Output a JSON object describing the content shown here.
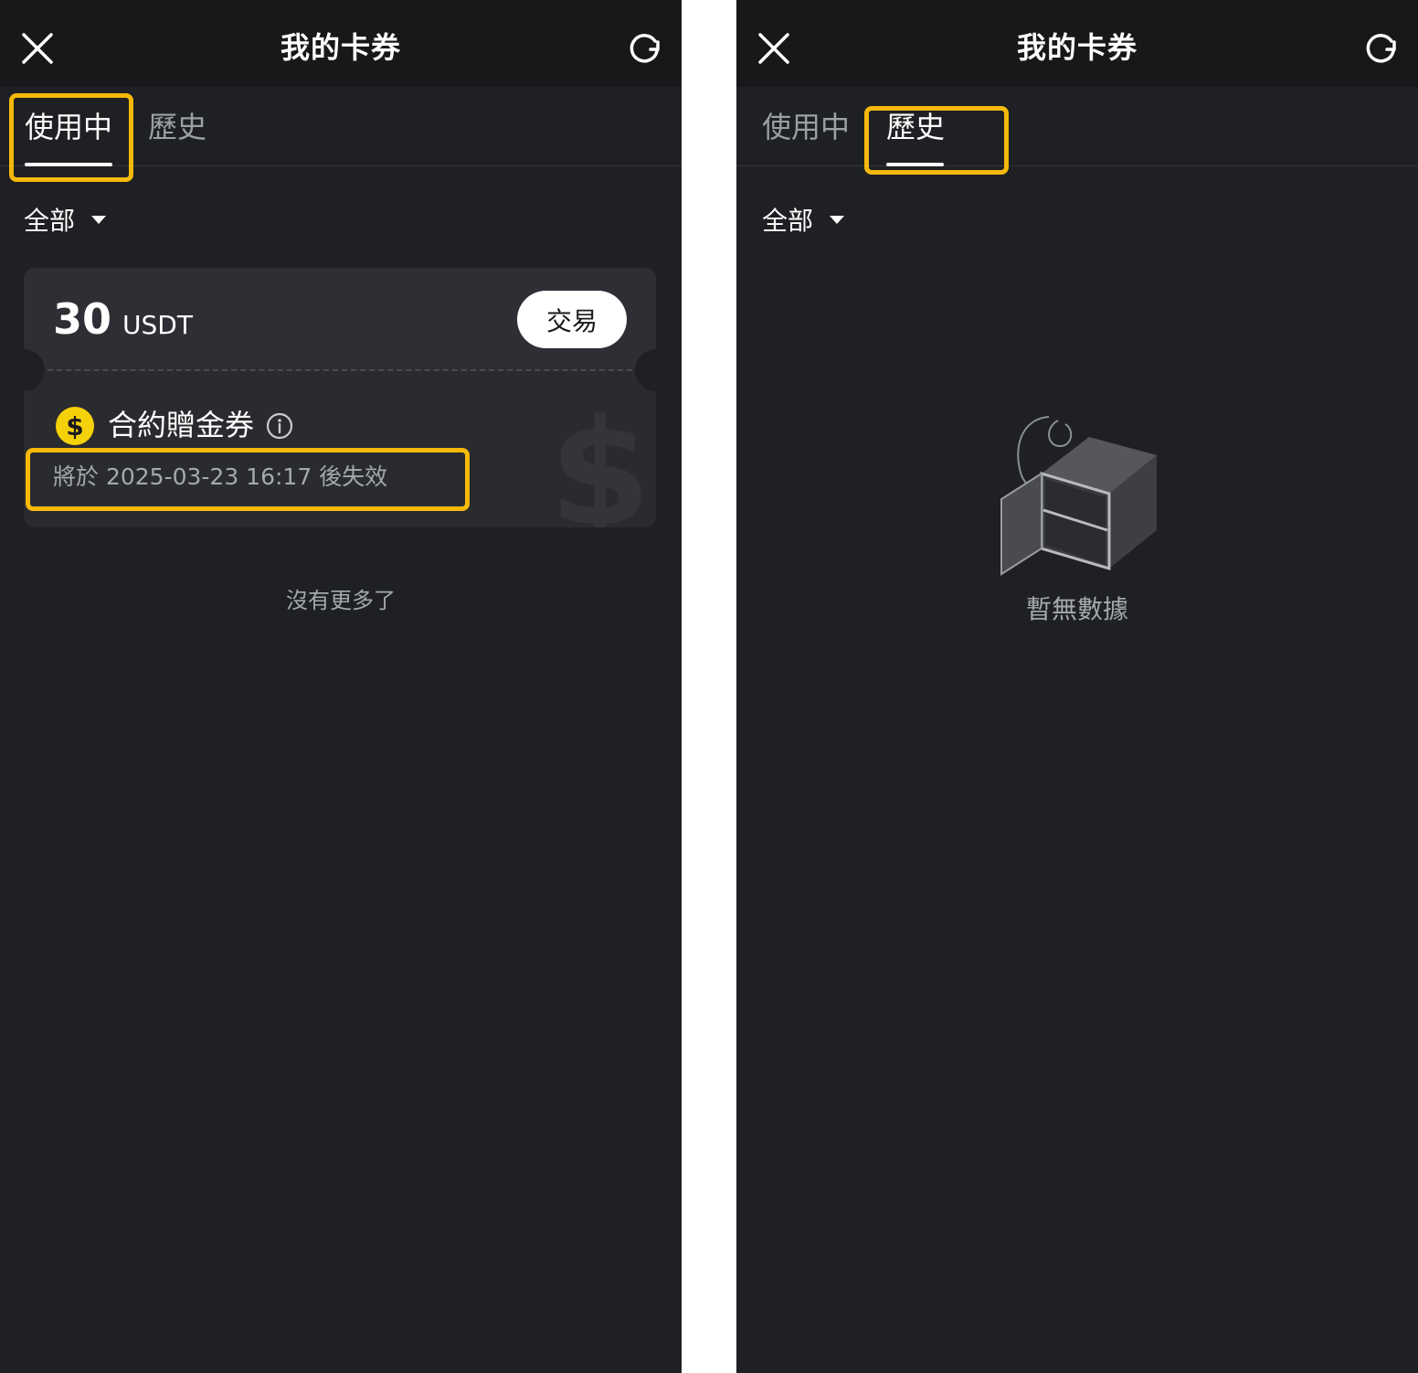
{
  "left_panel": {
    "header": {
      "title": "我的卡券"
    },
    "tabs": [
      {
        "label": "使用中",
        "active": true
      },
      {
        "label": "歷史",
        "active": false
      }
    ],
    "filter": {
      "label": "全部"
    },
    "coupon": {
      "amount": "30",
      "unit": "USDT",
      "action_label": "交易",
      "coin_symbol": "$",
      "name": "合約贈金券",
      "expiry": "將於 2025-03-23 16:17 後失效",
      "watermark": "$"
    },
    "footer_note": "沒有更多了"
  },
  "right_panel": {
    "header": {
      "title": "我的卡券"
    },
    "tabs": [
      {
        "label": "使用中",
        "active": false
      },
      {
        "label": "歷史",
        "active": true
      }
    ],
    "filter": {
      "label": "全部"
    },
    "empty_state": {
      "text": "暫無數據",
      "icon": "empty-box-icon"
    }
  },
  "colors": {
    "background": "#1f2023",
    "header": "#17181a",
    "highlight": "#f5b90a",
    "coin": "#f5d10a",
    "text_primary": "#ffffff",
    "text_secondary": "#a5a8ae"
  }
}
